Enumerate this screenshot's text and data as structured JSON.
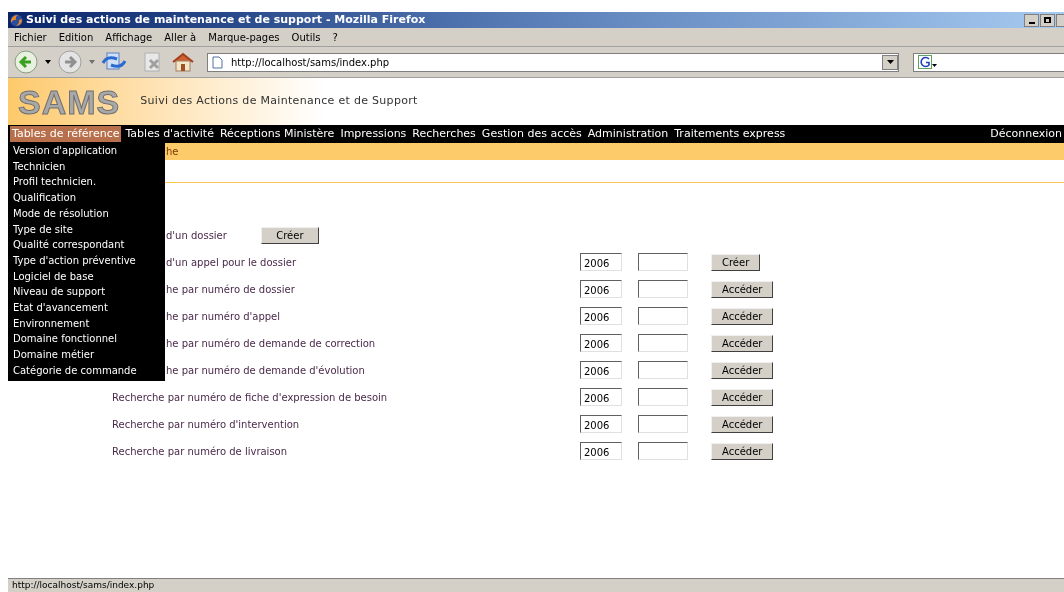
{
  "window": {
    "title": "Suivi des actions de maintenance et de support - Mozilla Firefox"
  },
  "menu_bar": [
    "Fichier",
    "Edition",
    "Affichage",
    "Aller à",
    "Marque-pages",
    "Outils",
    "?"
  ],
  "toolbar": {
    "url": "http://localhost/sams/index.php"
  },
  "header": {
    "logo": "SAMS",
    "tagline": "Suivi des Actions de Maintenance et de Support"
  },
  "nav": [
    {
      "label": "Tables de référence",
      "selected": true
    },
    {
      "label": "Tables d'activité",
      "selected": false
    },
    {
      "label": "Réceptions Ministère",
      "selected": false
    },
    {
      "label": "Impressions",
      "selected": false
    },
    {
      "label": "Recherches",
      "selected": false
    },
    {
      "label": "Gestion des accès",
      "selected": false
    },
    {
      "label": "Administration",
      "selected": false
    },
    {
      "label": "Traitements express",
      "selected": false
    }
  ],
  "logout": "Déconnexion",
  "dropdown": [
    "Version d'application",
    "Technicien",
    "Profil technicien.",
    "Qualification",
    "Mode de résolution",
    "Type de site",
    "Qualité correspondant",
    "Type d'action préventive",
    "Logiciel de base",
    "Niveau de support",
    "Etat d'avancement",
    "Environnement",
    "Domaine fonctionnel",
    "Domaine métier",
    "Catégorie de commande"
  ],
  "breadcrumb": "he",
  "rows": [
    {
      "kind": "create",
      "label": "d'un dossier",
      "button": "Créer"
    },
    {
      "kind": "lookup",
      "label": "d'un appel pour le dossier",
      "year": "2006",
      "button": "Créer"
    },
    {
      "kind": "lookup",
      "label": "he par numéro de dossier",
      "year": "2006",
      "button": "Accéder"
    },
    {
      "kind": "lookup",
      "label": "he par numéro d'appel",
      "year": "2006",
      "button": "Accéder"
    },
    {
      "kind": "lookup",
      "label": "he par numéro de demande de correction",
      "year": "2006",
      "button": "Accéder"
    },
    {
      "kind": "lookup",
      "label": "he par numéro de demande d'évolution",
      "year": "2006",
      "button": "Accéder"
    },
    {
      "kind": "lookup",
      "label": "Recherche par numéro de fiche d'expression de besoin",
      "year": "2006",
      "button": "Accéder"
    },
    {
      "kind": "lookup",
      "label": "Recherche par numéro d'intervention",
      "year": "2006",
      "button": "Accéder"
    },
    {
      "kind": "lookup",
      "label": "Recherche par numéro de livraison",
      "year": "2006",
      "button": "Accéder"
    }
  ],
  "status_bar": "http://localhost/sams/index.php"
}
